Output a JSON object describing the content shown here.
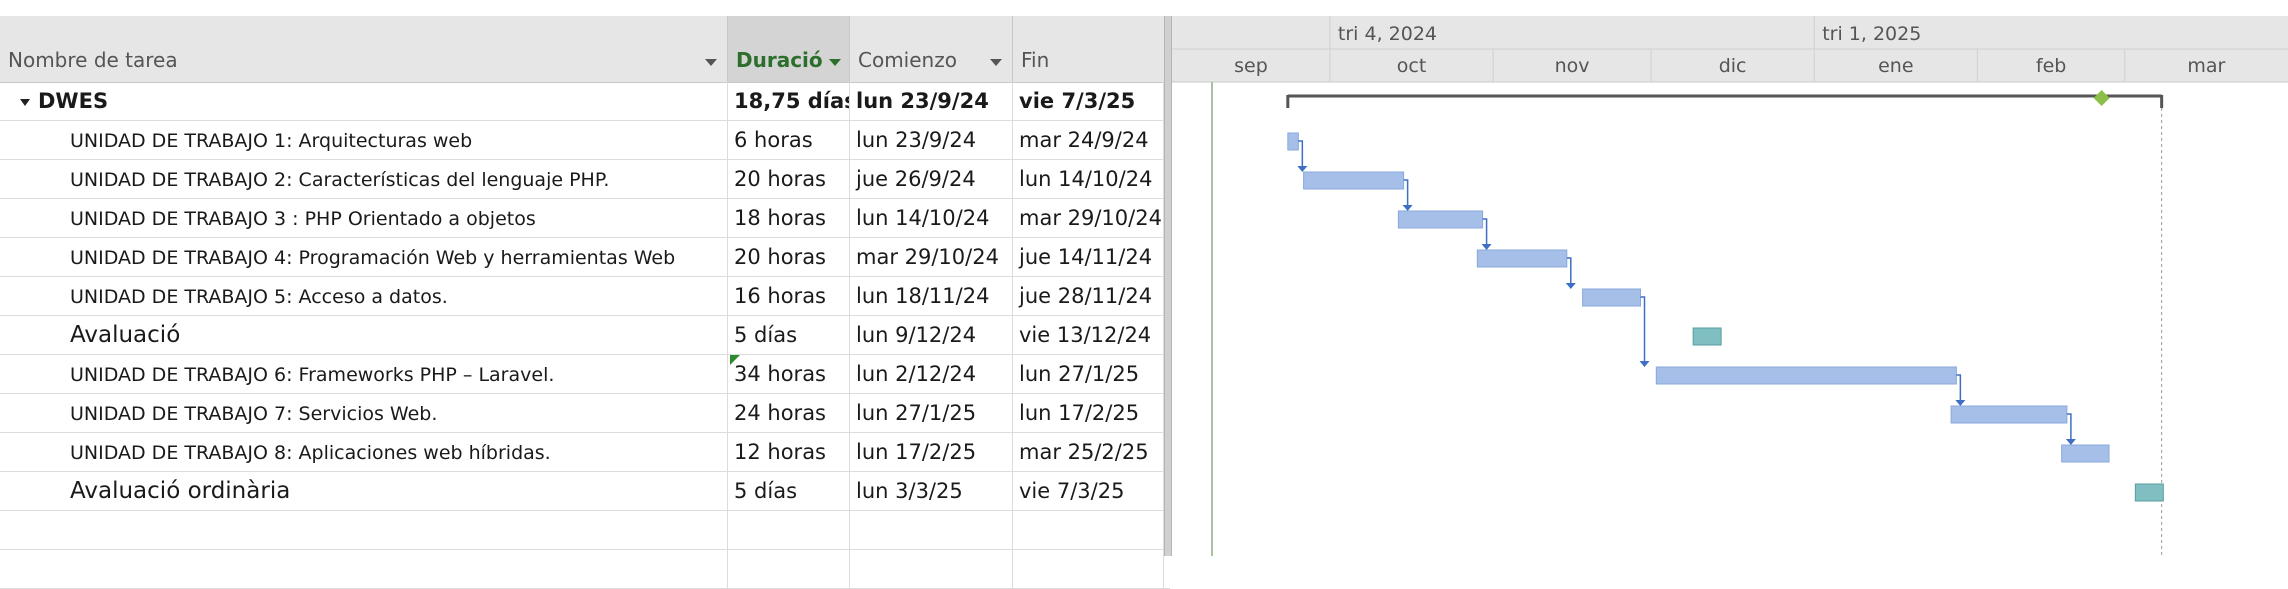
{
  "columns": {
    "name": "Nombre de tarea",
    "duration": "Duració",
    "start": "Comienzo",
    "end": "Fin"
  },
  "timescale": {
    "quarters": [
      {
        "label": "tri 4, 2024"
      },
      {
        "label": "tri 1, 2025"
      }
    ],
    "months": [
      "sep",
      "oct",
      "nov",
      "dic",
      "ene",
      "feb",
      "mar"
    ]
  },
  "tasks": [
    {
      "name": "DWES",
      "duration": "18,75 días",
      "start": "lun 23/9/24",
      "end": "vie 7/3/25",
      "type": "summary"
    },
    {
      "name": "UNIDAD DE TRABAJO 1: Arquitecturas web",
      "duration": "6 horas",
      "start": "lun 23/9/24",
      "end": "mar 24/9/24",
      "type": "task"
    },
    {
      "name": "UNIDAD DE TRABAJO 2: Características del lenguaje PHP.",
      "duration": "20 horas",
      "start": "jue 26/9/24",
      "end": "lun 14/10/24",
      "type": "task"
    },
    {
      "name": "UNIDAD DE TRABAJO 3 : PHP Orientado a objetos",
      "duration": "18 horas",
      "start": "lun 14/10/24",
      "end": "mar 29/10/24",
      "type": "task"
    },
    {
      "name": "UNIDAD DE TRABAJO 4:  Programación Web y herramientas Web",
      "duration": "20 horas",
      "start": "mar 29/10/24",
      "end": "jue 14/11/24",
      "type": "task"
    },
    {
      "name": "UNIDAD DE TRABAJO 5: Acceso a datos.",
      "duration": "16 horas",
      "start": "lun 18/11/24",
      "end": "jue 28/11/24",
      "type": "task"
    },
    {
      "name": "Avaluació",
      "duration": "5 días",
      "start": "lun 9/12/24",
      "end": "vie 13/12/24",
      "type": "manual"
    },
    {
      "name": "UNIDAD DE TRABAJO 6: Frameworks PHP – Laravel.",
      "duration": "34 horas",
      "start": "lun 2/12/24",
      "end": "lun 27/1/25",
      "type": "task",
      "note": true
    },
    {
      "name": "UNIDAD DE TRABAJO 7: Servicios Web.",
      "duration": "24 horas",
      "start": "lun 27/1/25",
      "end": "lun 17/2/25",
      "type": "task"
    },
    {
      "name": "UNIDAD DE TRABAJO 8: Aplicaciones web híbridas.",
      "duration": "12 horas",
      "start": "lun 17/2/25",
      "end": "mar 25/2/25",
      "type": "task"
    },
    {
      "name": "Avaluació ordinària",
      "duration": "5 días",
      "start": "lun 3/3/25",
      "end": "vie 7/3/25",
      "type": "manual"
    }
  ],
  "colors": {
    "task_bar": "#a6bfe8",
    "manual_bar": "#7fbfc1",
    "link": "#3e6fc4",
    "summary": "#555555",
    "milestone": "#8cbf4a"
  }
}
